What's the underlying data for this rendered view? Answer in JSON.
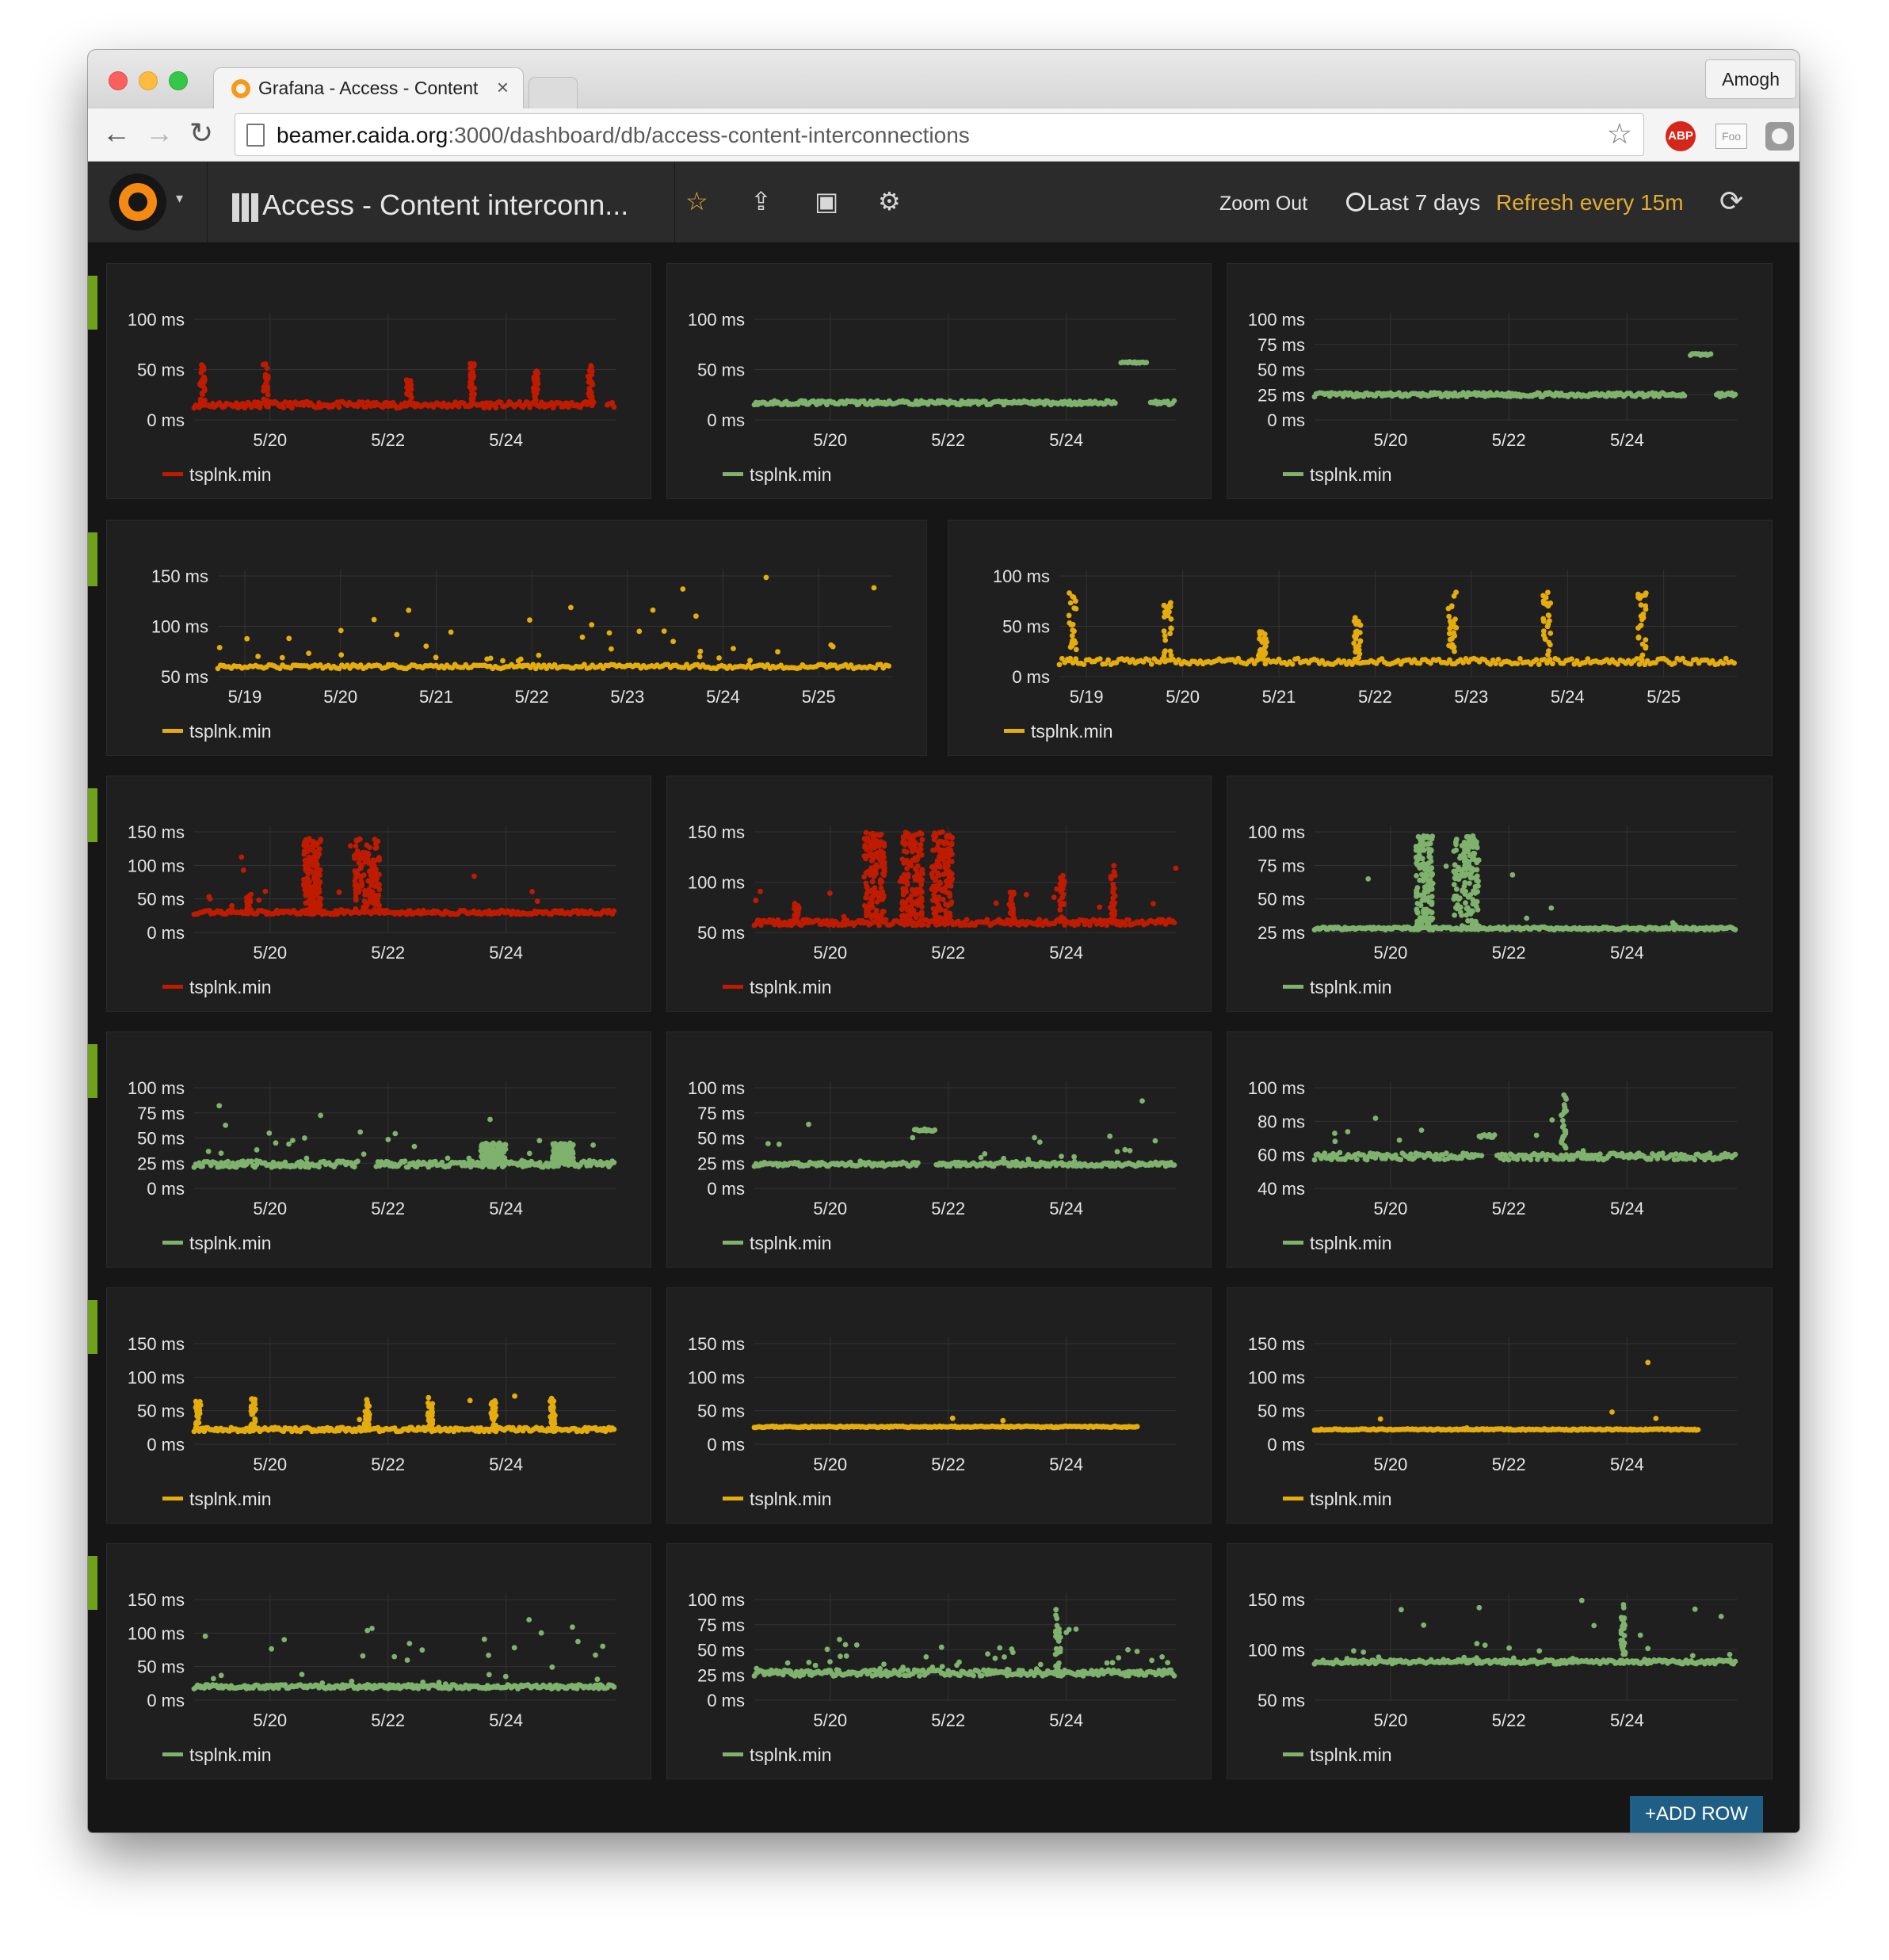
{
  "browser": {
    "tab_title": "Grafana - Access - Content",
    "tab_close": "×",
    "profile": "Amogh",
    "nav": {
      "back": "←",
      "forward": "→",
      "reload": "↻"
    },
    "url_host": "beamer.caida.org",
    "url_rest": ":3000/dashboard/db/access-content-interconnections",
    "extensions": {
      "abp": "ABP",
      "ipvfoo": "Foo"
    }
  },
  "grafana": {
    "title": "Access - Content interconn...",
    "toolbar": {
      "star": "☆",
      "share": "⇪",
      "save": "▣",
      "settings": "⚙"
    },
    "zoom_out": "Zoom Out",
    "time_range": "Last 7 days",
    "refresh": "Refresh every 15m",
    "refresh_icon": "⟳",
    "add_row": "+ADD ROW"
  },
  "colors": {
    "red": "#bf1b00",
    "green": "#7eb26d",
    "yellow": "#e5ac0e"
  },
  "chart_data": [
    {
      "type": "scatter",
      "series": [
        {
          "name": "tsplnk.min",
          "color": "red"
        }
      ],
      "y_ticks": [
        "100 ms",
        "50 ms",
        "0 ms"
      ],
      "ylim": [
        0,
        100
      ],
      "x_ticks": [
        "5/20",
        "5/22",
        "5/24"
      ],
      "baseline": 15,
      "noise": 3,
      "spikes": [
        {
          "x": 0.02,
          "h": 55
        },
        {
          "x": 0.17,
          "h": 58
        },
        {
          "x": 0.51,
          "h": 40
        },
        {
          "x": 0.66,
          "h": 57
        },
        {
          "x": 0.81,
          "h": 50
        },
        {
          "x": 0.94,
          "h": 58
        }
      ],
      "gaps": [
        [
          0.95,
          0.98
        ]
      ],
      "seed": 11
    },
    {
      "type": "scatter",
      "series": [
        {
          "name": "tsplnk.min",
          "color": "green"
        }
      ],
      "y_ticks": [
        "100 ms",
        "50 ms",
        "0 ms"
      ],
      "ylim": [
        0,
        100
      ],
      "x_ticks": [
        "5/20",
        "5/22",
        "5/24"
      ],
      "baseline": 17,
      "noise": 2,
      "levels": [
        {
          "x0": 0.87,
          "x1": 0.93,
          "y": 57
        }
      ],
      "gaps": [
        [
          0.86,
          0.94
        ]
      ],
      "seed": 12
    },
    {
      "type": "scatter",
      "series": [
        {
          "name": "tsplnk.min",
          "color": "green"
        }
      ],
      "y_ticks": [
        "100 ms",
        "75 ms",
        "50 ms",
        "25 ms",
        "0 ms"
      ],
      "ylim": [
        0,
        100
      ],
      "x_ticks": [
        "5/20",
        "5/22",
        "5/24"
      ],
      "baseline": 25,
      "noise": 2,
      "levels": [
        {
          "x0": 0.89,
          "x1": 0.94,
          "y": 65
        }
      ],
      "gaps": [
        [
          0.88,
          0.95
        ]
      ],
      "seed": 13
    },
    {
      "type": "scatter",
      "series": [
        {
          "name": "tsplnk.min",
          "color": "yellow"
        }
      ],
      "y_ticks": [
        "150 ms",
        "100 ms",
        "50 ms"
      ],
      "ylim": [
        50,
        150
      ],
      "x_ticks": [
        "5/19",
        "5/20",
        "5/21",
        "5/22",
        "5/23",
        "5/24",
        "5/25"
      ],
      "baseline": 60,
      "noise": 2,
      "outliers": 48,
      "seed": 14
    },
    {
      "type": "scatter",
      "series": [
        {
          "name": "tsplnk.min",
          "color": "yellow"
        }
      ],
      "y_ticks": [
        "100 ms",
        "50 ms",
        "0 ms"
      ],
      "ylim": [
        0,
        100
      ],
      "x_ticks": [
        "5/19",
        "5/20",
        "5/21",
        "5/22",
        "5/23",
        "5/24",
        "5/25"
      ],
      "baseline": 15,
      "noise": 3,
      "spikes": [
        {
          "x": 0.02,
          "h": 85
        },
        {
          "x": 0.16,
          "h": 75
        },
        {
          "x": 0.3,
          "h": 50
        },
        {
          "x": 0.44,
          "h": 60
        },
        {
          "x": 0.58,
          "h": 85
        },
        {
          "x": 0.72,
          "h": 85
        },
        {
          "x": 0.86,
          "h": 85
        }
      ],
      "seed": 15
    },
    {
      "type": "scatter",
      "series": [
        {
          "name": "tsplnk.min",
          "color": "red"
        }
      ],
      "y_ticks": [
        "150 ms",
        "100 ms",
        "50 ms",
        "0 ms"
      ],
      "ylim": [
        0,
        150
      ],
      "x_ticks": [
        "5/20",
        "5/22",
        "5/24"
      ],
      "baseline": 30,
      "noise": 3,
      "bursts": [
        {
          "x0": 0.26,
          "x1": 0.3,
          "top": 140
        },
        {
          "x0": 0.38,
          "x1": 0.44,
          "top": 140
        }
      ],
      "spikes": [
        {
          "x": 0.13,
          "h": 60
        }
      ],
      "outliers": 18,
      "seed": 16
    },
    {
      "type": "scatter",
      "series": [
        {
          "name": "tsplnk.min",
          "color": "red"
        }
      ],
      "y_ticks": [
        "150 ms",
        "100 ms",
        "50 ms"
      ],
      "ylim": [
        50,
        150
      ],
      "x_ticks": [
        "5/20",
        "5/22",
        "5/24"
      ],
      "baseline": 60,
      "noise": 3,
      "bursts": [
        {
          "x0": 0.26,
          "x1": 0.31,
          "top": 150
        },
        {
          "x0": 0.35,
          "x1": 0.4,
          "top": 150
        },
        {
          "x0": 0.42,
          "x1": 0.47,
          "top": 150
        }
      ],
      "spikes": [
        {
          "x": 0.1,
          "h": 80
        },
        {
          "x": 0.61,
          "h": 90
        },
        {
          "x": 0.73,
          "h": 110
        },
        {
          "x": 0.85,
          "h": 120
        }
      ],
      "outliers": 14,
      "seed": 17
    },
    {
      "type": "scatter",
      "series": [
        {
          "name": "tsplnk.min",
          "color": "green"
        }
      ],
      "y_ticks": [
        "100 ms",
        "75 ms",
        "50 ms",
        "25 ms"
      ],
      "ylim": [
        25,
        100
      ],
      "x_ticks": [
        "5/20",
        "5/22",
        "5/24"
      ],
      "baseline": 28,
      "noise": 1,
      "bursts": [
        {
          "x0": 0.24,
          "x1": 0.28,
          "top": 97
        },
        {
          "x0": 0.33,
          "x1": 0.39,
          "top": 97
        }
      ],
      "outliers": 8,
      "seed": 18
    },
    {
      "type": "scatter",
      "series": [
        {
          "name": "tsplnk.min",
          "color": "green"
        }
      ],
      "y_ticks": [
        "100 ms",
        "75 ms",
        "50 ms",
        "25 ms",
        "0 ms"
      ],
      "ylim": [
        0,
        100
      ],
      "x_ticks": [
        "5/20",
        "5/22",
        "5/24"
      ],
      "baseline": 24,
      "noise": 3,
      "outliers": 35,
      "gaps": [
        [
          0.39,
          0.43
        ]
      ],
      "bursts": [
        {
          "x0": 0.68,
          "x1": 0.74,
          "top": 45
        },
        {
          "x0": 0.85,
          "x1": 0.9,
          "top": 45
        }
      ],
      "seed": 19
    },
    {
      "type": "scatter",
      "series": [
        {
          "name": "tsplnk.min",
          "color": "green"
        }
      ],
      "y_ticks": [
        "100 ms",
        "75 ms",
        "50 ms",
        "25 ms",
        "0 ms"
      ],
      "ylim": [
        0,
        100
      ],
      "x_ticks": [
        "5/20",
        "5/22",
        "5/24"
      ],
      "baseline": 24,
      "noise": 2,
      "outliers": 22,
      "gaps": [
        [
          0.39,
          0.43
        ]
      ],
      "levels": [
        {
          "x0": 0.38,
          "x1": 0.43,
          "y": 58
        }
      ],
      "seed": 20
    },
    {
      "type": "scatter",
      "series": [
        {
          "name": "tsplnk.min",
          "color": "green"
        }
      ],
      "y_ticks": [
        "100 ms",
        "80 ms",
        "60 ms",
        "40 ms"
      ],
      "ylim": [
        40,
        100
      ],
      "x_ticks": [
        "5/20",
        "5/22",
        "5/24"
      ],
      "baseline": 59,
      "noise": 2,
      "outliers": 14,
      "gaps": [
        [
          0.39,
          0.43
        ]
      ],
      "levels": [
        {
          "x0": 0.39,
          "x1": 0.43,
          "y": 71
        }
      ],
      "spikes": [
        {
          "x": 0.59,
          "h": 97
        }
      ],
      "seed": 21
    },
    {
      "type": "scatter",
      "series": [
        {
          "name": "tsplnk.min",
          "color": "yellow"
        }
      ],
      "y_ticks": [
        "150 ms",
        "100 ms",
        "50 ms",
        "0 ms"
      ],
      "ylim": [
        0,
        150
      ],
      "x_ticks": [
        "5/20",
        "5/22",
        "5/24"
      ],
      "baseline": 22,
      "noise": 3,
      "spikes": [
        {
          "x": 0.01,
          "h": 65
        },
        {
          "x": 0.14,
          "h": 70
        },
        {
          "x": 0.41,
          "h": 68
        },
        {
          "x": 0.56,
          "h": 70
        },
        {
          "x": 0.71,
          "h": 65
        },
        {
          "x": 0.85,
          "h": 70
        }
      ],
      "outliers": 4,
      "seed": 22
    },
    {
      "type": "scatter",
      "series": [
        {
          "name": "tsplnk.min",
          "color": "yellow"
        }
      ],
      "y_ticks": [
        "150 ms",
        "100 ms",
        "50 ms",
        "0 ms"
      ],
      "ylim": [
        0,
        150
      ],
      "x_ticks": [
        "5/20",
        "5/22",
        "5/24"
      ],
      "baseline": 26,
      "noise": 1,
      "gaps": [
        [
          0.91,
          1.0
        ]
      ],
      "outliers": 2,
      "seed": 23
    },
    {
      "type": "scatter",
      "series": [
        {
          "name": "tsplnk.min",
          "color": "yellow"
        }
      ],
      "y_ticks": [
        "150 ms",
        "100 ms",
        "50 ms",
        "0 ms"
      ],
      "ylim": [
        0,
        150
      ],
      "x_ticks": [
        "5/20",
        "5/22",
        "5/24"
      ],
      "baseline": 22,
      "noise": 1,
      "gaps": [
        [
          0.91,
          1.0
        ]
      ],
      "outliers": 5,
      "seed": 24
    },
    {
      "type": "scatter",
      "series": [
        {
          "name": "tsplnk.min",
          "color": "green"
        }
      ],
      "y_ticks": [
        "150 ms",
        "100 ms",
        "50 ms",
        "0 ms"
      ],
      "ylim": [
        0,
        150
      ],
      "x_ticks": [
        "5/20",
        "5/22",
        "5/24"
      ],
      "baseline": 20,
      "noise": 3,
      "outliers": 38,
      "seed": 25
    },
    {
      "type": "scatter",
      "series": [
        {
          "name": "tsplnk.min",
          "color": "green"
        }
      ],
      "y_ticks": [
        "100 ms",
        "75 ms",
        "50 ms",
        "25 ms",
        "0 ms"
      ],
      "ylim": [
        0,
        100
      ],
      "x_ticks": [
        "5/20",
        "5/22",
        "5/24"
      ],
      "baseline": 27,
      "noise": 3,
      "outliers": 50,
      "spikes": [
        {
          "x": 0.72,
          "h": 90
        }
      ],
      "seed": 26
    },
    {
      "type": "scatter",
      "series": [
        {
          "name": "tsplnk.min",
          "color": "green"
        }
      ],
      "y_ticks": [
        "150 ms",
        "100 ms",
        "50 ms"
      ],
      "ylim": [
        50,
        150
      ],
      "x_ticks": [
        "5/20",
        "5/22",
        "5/24"
      ],
      "baseline": 88,
      "noise": 2,
      "outliers": 30,
      "spikes": [
        {
          "x": 0.73,
          "h": 145
        }
      ],
      "seed": 27
    }
  ]
}
